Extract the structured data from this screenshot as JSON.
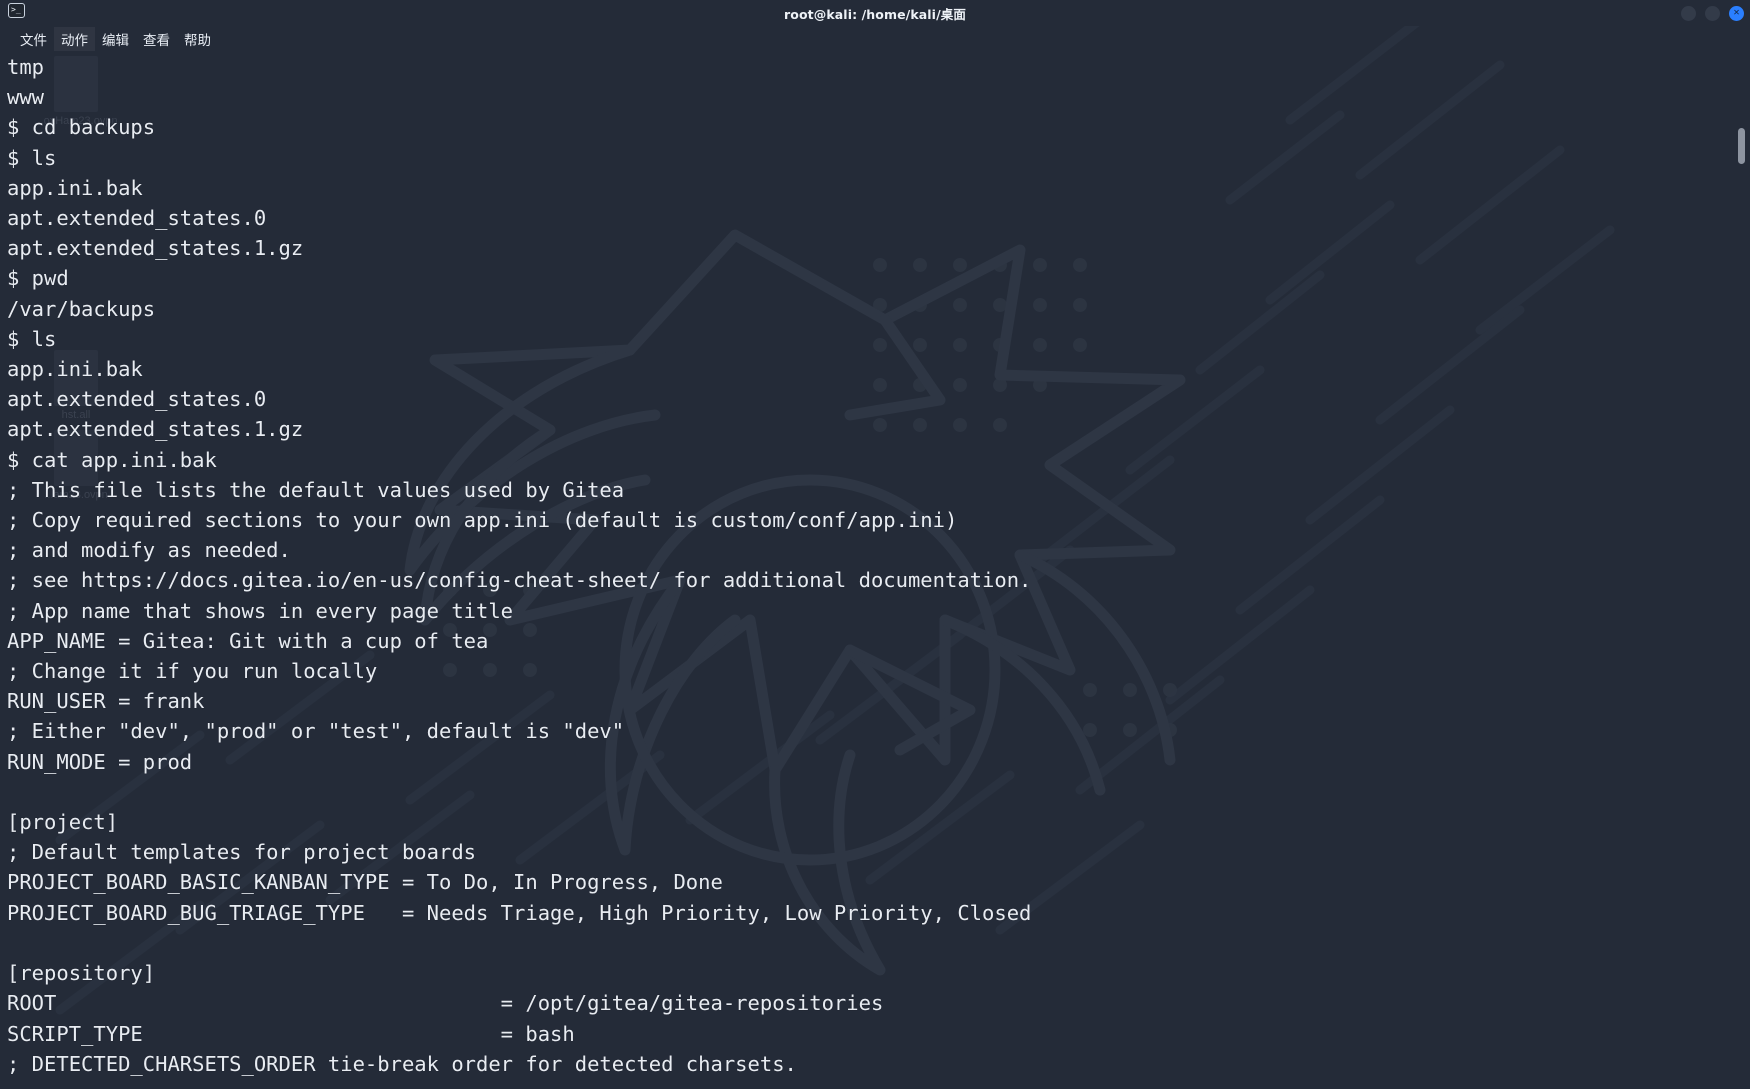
{
  "window": {
    "title": "root@kali: /home/kali/桌面",
    "app_icon": "terminal-icon",
    "controls": {
      "minimize": "minimize-button",
      "maximize": "maximize-button",
      "close_glyph": "✕"
    }
  },
  "menubar": {
    "items": [
      {
        "label": "文件",
        "name": "menu-file"
      },
      {
        "label": "动作",
        "name": "menu-actions"
      },
      {
        "label": "编辑",
        "name": "menu-edit"
      },
      {
        "label": "查看",
        "name": "menu-view"
      },
      {
        "label": "帮助",
        "name": "menu-help"
      }
    ]
  },
  "desktop_icons": [
    {
      "label": "...oxHam23.ovpn"
    },
    {
      "label": "hst.all"
    },
    {
      "label": "...am23.ovpn"
    }
  ],
  "terminal": {
    "prompt": "$",
    "lines": [
      "tmp",
      "www",
      "$ cd backups",
      "$ ls",
      "app.ini.bak",
      "apt.extended_states.0",
      "apt.extended_states.1.gz",
      "$ pwd",
      "/var/backups",
      "$ ls",
      "app.ini.bak",
      "apt.extended_states.0",
      "apt.extended_states.1.gz",
      "$ cat app.ini.bak",
      "; This file lists the default values used by Gitea",
      "; Copy required sections to your own app.ini (default is custom/conf/app.ini)",
      "; and modify as needed.",
      "; see https://docs.gitea.io/en-us/config-cheat-sheet/ for additional documentation.",
      "; App name that shows in every page title",
      "APP_NAME = Gitea: Git with a cup of tea",
      "; Change it if you run locally",
      "RUN_USER = frank",
      "; Either \"dev\", \"prod\" or \"test\", default is \"dev\"",
      "RUN_MODE = prod",
      "",
      "[project]",
      "; Default templates for project boards",
      "PROJECT_BOARD_BASIC_KANBAN_TYPE = To Do, In Progress, Done",
      "PROJECT_BOARD_BUG_TRIAGE_TYPE   = Needs Triage, High Priority, Low Priority, Closed",
      "",
      "[repository]",
      "ROOT                                    = /opt/gitea/gitea-repositories",
      "SCRIPT_TYPE                             = bash",
      "; DETECTED_CHARSETS_ORDER tie-break order for detected charsets."
    ]
  },
  "colors": {
    "background": "#242b38",
    "text": "#e8ecf2",
    "titlebar": "#242b38",
    "close_button": "#2a7fff",
    "scrollbar_thumb": "#8d94a0"
  }
}
